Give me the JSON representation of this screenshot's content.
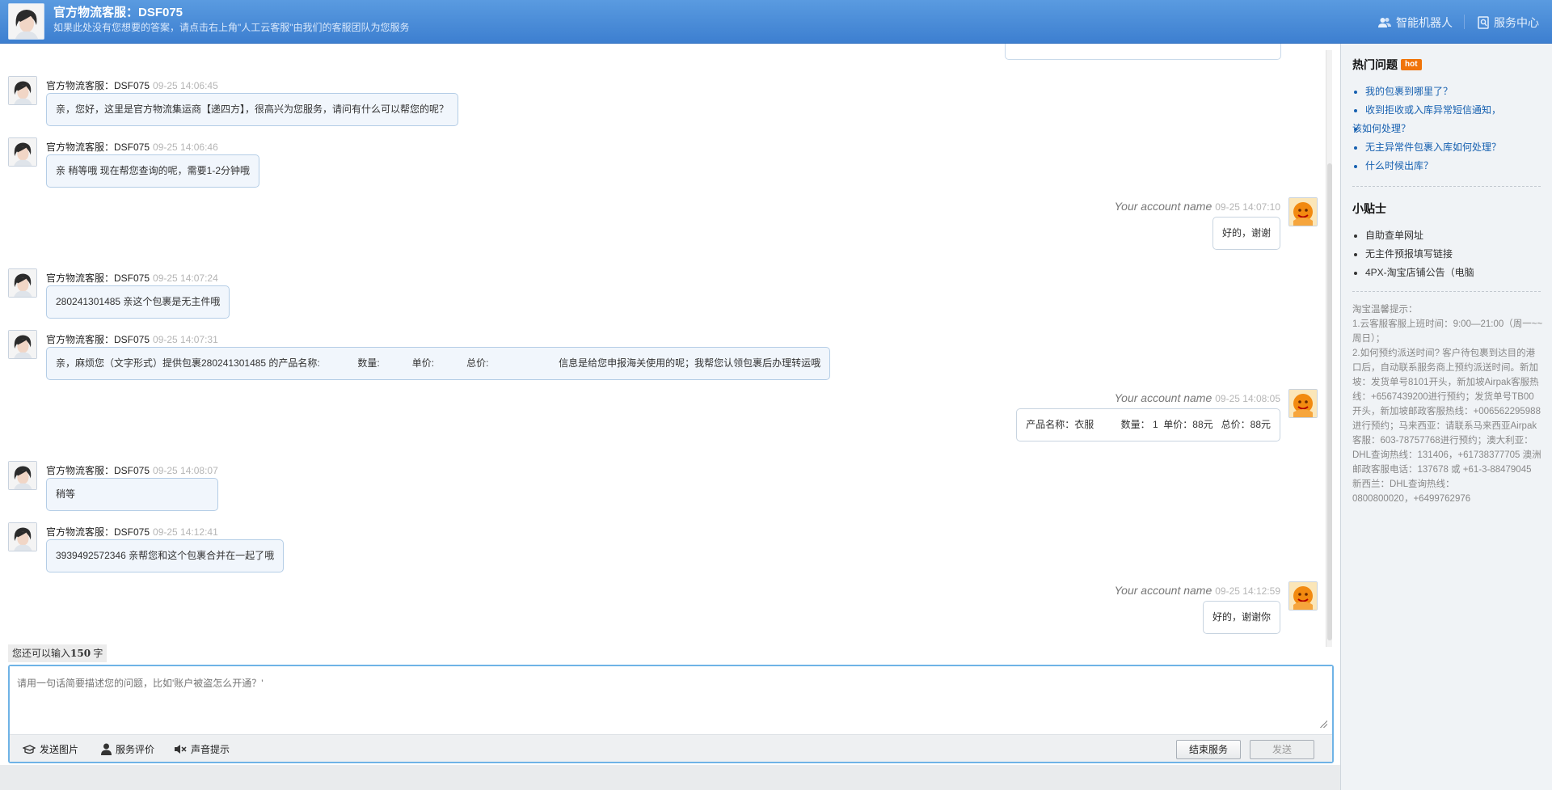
{
  "header": {
    "title": "官方物流客服：DSF075",
    "subtitle": "如果此处没有您想要的答案，请点击右上角\"人工云客服\"由我们的客服团队为您服务",
    "robot_label": "智能机器人",
    "service_label": "服务中心"
  },
  "messages": [
    {
      "role": "agent",
      "name": "官方物流客服：DSF075",
      "time": "09-25 14:06:45",
      "text": "亲，您好，这里是官方物流集运商【递四方】，很高兴为您服务，请问有什么可以帮您的呢？"
    },
    {
      "role": "agent",
      "name": "官方物流客服：DSF075",
      "time": "09-25 14:06:46",
      "text": "亲 稍等哦 现在帮您查询的呢，需要1-2分钟哦"
    },
    {
      "role": "user",
      "name": "Your account name",
      "time": "09-25 14:07:10",
      "text": "好的，谢谢"
    },
    {
      "role": "agent",
      "name": "官方物流客服：DSF075",
      "time": "09-25 14:07:24",
      "text": "280241301485 亲这个包裹是无主件哦"
    },
    {
      "role": "agent",
      "name": "官方物流客服：DSF075",
      "time": "09-25 14:07:31",
      "text": "亲，麻烦您（文字形式）提供包裹280241301485 的产品名称:              数量:            单价:            总价:                          信息是给您申报海关使用的呢；我帮您认领包裹后办理转运哦"
    },
    {
      "role": "user",
      "name": "Your account name",
      "time": "09-25 14:08:05",
      "text": "产品名称：衣服          数量： 1  单价：88元   总价：88元"
    },
    {
      "role": "agent",
      "name": "官方物流客服：DSF075",
      "time": "09-25 14:08:07",
      "text": "稍等"
    },
    {
      "role": "agent",
      "name": "官方物流客服：DSF075",
      "time": "09-25 14:12:41",
      "text": "3939492572346 亲帮您和这个包裹合并在一起了哦"
    },
    {
      "role": "user",
      "name": "Your account name",
      "time": "09-25 14:12:59",
      "text": "好的，谢谢你"
    }
  ],
  "input": {
    "counter_prefix": "您还可以输入",
    "counter_num": "150",
    "counter_suffix": " 字",
    "placeholder": "请用一句话简要描述您的问题，比如'账户被盗怎么开通？'"
  },
  "toolbar": {
    "send_image": "发送图片",
    "rate_service": "服务评价",
    "sound_alert": "声音提示",
    "end_service": "结束服务",
    "send": "发送"
  },
  "side": {
    "hot_title": "热门问题",
    "hot_badge": "hot",
    "hot_questions": [
      "我的包裹到哪里了？",
      "收到拒收或入库异常短信通知，",
      "该如何处理？",
      "无主异常件包裹入库如何处理？",
      "什么时候出库？"
    ],
    "tips_title": "小贴士",
    "tips_links": [
      "自助查单网址",
      "无主件预报填写链接",
      "4PX-淘宝店铺公告（电脑"
    ],
    "notice": "淘宝温馨提示：\n1.云客服客服上班时间：9:00—21:00（周一~~周日）；\n2.如何预约派送时间? 客户待包裹到达目的港口后，自动联系服务商上预约派送时间。新加坡：发货单号8101开头，新加坡Airpak客服热线：+6567439200进行预约；发货单号TB00开头，新加坡邮政客服热线：+006562295988 进行预约；马来西亚：请联系马来西亚Airpak 客服：603-78757768进行预约；澳大利亚：DHL查询热线：131406，+61738377705 澳洲邮政客服电话：137678 或 +61-3-88479045 新西兰：DHL查询热线：0800800020，+6499762976"
  },
  "colors": {
    "header": "#4a8cdb",
    "link": "#1660b0",
    "hot": "#f0740a",
    "input_border": "#6fb3e6"
  }
}
